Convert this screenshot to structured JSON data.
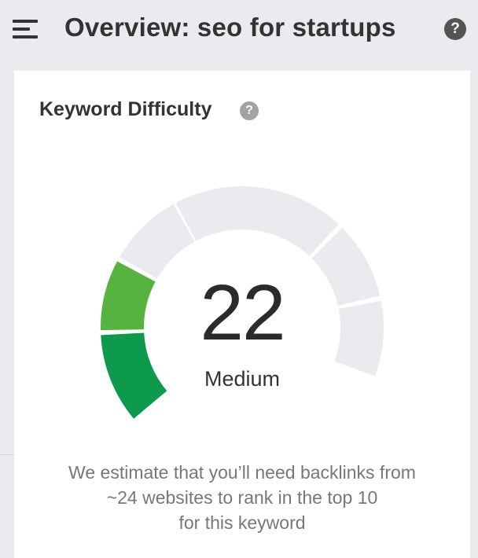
{
  "header": {
    "title": "Overview: seo for startups",
    "menu_icon": "hamburger-menu-icon",
    "help_icon": "help-circle-icon",
    "help_glyph": "?"
  },
  "card": {
    "title": "Keyword Difficulty",
    "help_glyph": "?",
    "gauge": {
      "score": "22",
      "score_value": 22,
      "level": "Medium",
      "filled_segments": 2,
      "total_segments": 6,
      "colors": {
        "filled_dark": "#0e9a4d",
        "filled_light": "#56b33f",
        "empty": "#e9ebee"
      }
    },
    "estimate_lines": [
      "We estimate that you’ll need backlinks from",
      "~24 websites to rank in the top 10",
      "for this keyword"
    ]
  }
}
